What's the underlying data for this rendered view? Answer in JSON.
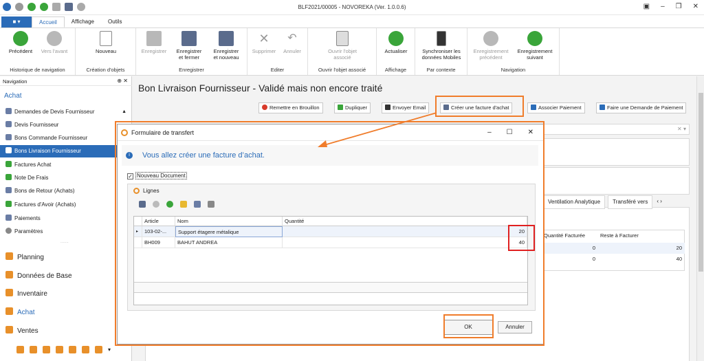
{
  "window": {
    "title": "BLF2021/00005 - NOVOREKA (Ver. 1.0.0.6)"
  },
  "tabs": [
    {
      "label": "Accueil"
    },
    {
      "label": "Affichage"
    },
    {
      "label": "Outils"
    }
  ],
  "ribbon": {
    "groups": [
      {
        "label": "Historique de navigation",
        "buttons": [
          "Précédent",
          "Vers l'avant"
        ]
      },
      {
        "label": "Création d'objets",
        "buttons": [
          "Nouveau"
        ]
      },
      {
        "label": "Enregistrer",
        "buttons": [
          "Enregistrer",
          "Enregistrer\net fermer",
          "Enregistrer\net nouveau"
        ]
      },
      {
        "label": "Editer",
        "buttons": [
          "Supprimer",
          "Annuler"
        ]
      },
      {
        "label": "Ouvrir l'objet associé",
        "buttons": [
          "Ouvrir l'objet\nassocié"
        ]
      },
      {
        "label": "Affichage",
        "buttons": [
          "Actualiser"
        ]
      },
      {
        "label": "Par contexte",
        "buttons": [
          "Synchroniser les\ndonnées Mobiles"
        ]
      },
      {
        "label": "Navigation",
        "buttons": [
          "Enregistrement\nprécédent",
          "Enregistrement\nsuivant"
        ]
      }
    ]
  },
  "nav": {
    "header": "Navigation",
    "title": "Achat",
    "items": [
      {
        "label": "Demandes de Devis Fournisseur"
      },
      {
        "label": "Devis Fournisseur"
      },
      {
        "label": "Bons Commande Fournisseur"
      },
      {
        "label": "Bons Livraison Fournisseur"
      },
      {
        "label": "Factures Achat"
      },
      {
        "label": "Note De Frais"
      },
      {
        "label": "Bons de Retour (Achats)"
      },
      {
        "label": "Factures d'Avoir (Achats)"
      },
      {
        "label": "Paiements"
      },
      {
        "label": "Paramètres"
      }
    ],
    "sections": [
      {
        "label": "Planning"
      },
      {
        "label": "Données de Base"
      },
      {
        "label": "Inventaire"
      },
      {
        "label": "Achat"
      },
      {
        "label": "Ventes"
      }
    ]
  },
  "main": {
    "title": "Bon Livraison Fournisseur - Validé mais non encore traité",
    "toolbar": [
      {
        "label": "Remettre en Brouillon",
        "color": "#d83b2b"
      },
      {
        "label": "Dupliquer",
        "color": "#3aa53a"
      },
      {
        "label": "Envoyer Email",
        "color": "#333333"
      },
      {
        "label": "Créer une facture d'achat",
        "color": "#5a6b8c"
      },
      {
        "label": "Associer Paiement",
        "color": "#2b6cb8"
      },
      {
        "label": "Faire une Demande de Paiement",
        "color": "#2b6cb8"
      }
    ],
    "right_tabs": [
      "Ventilation Analytique",
      "Transféré vers"
    ],
    "right_grid": {
      "headers": [
        "Quantité Facturée",
        "Reste à Facturer"
      ],
      "rows": [
        [
          "0",
          "20"
        ],
        [
          "0",
          "40"
        ]
      ]
    }
  },
  "dialog": {
    "title": "Formulaire de transfert",
    "info": "Vous allez créer une facture d’achat.",
    "checkbox_label": "Nouveau Document",
    "group_label": "Lignes",
    "columns": [
      "Article",
      "Nom",
      "Quantité"
    ],
    "rows": [
      {
        "article": "103-02-...",
        "nom": "Support étagere métalique",
        "quantite": "20"
      },
      {
        "article": "BH009",
        "nom": "BAHUT ANDREA",
        "quantite": "40"
      }
    ],
    "ok": "OK",
    "cancel": "Annuler"
  },
  "colors": {
    "accent": "#2b6cb8",
    "highlight": "#f07c2a",
    "alert": "#e02020"
  }
}
